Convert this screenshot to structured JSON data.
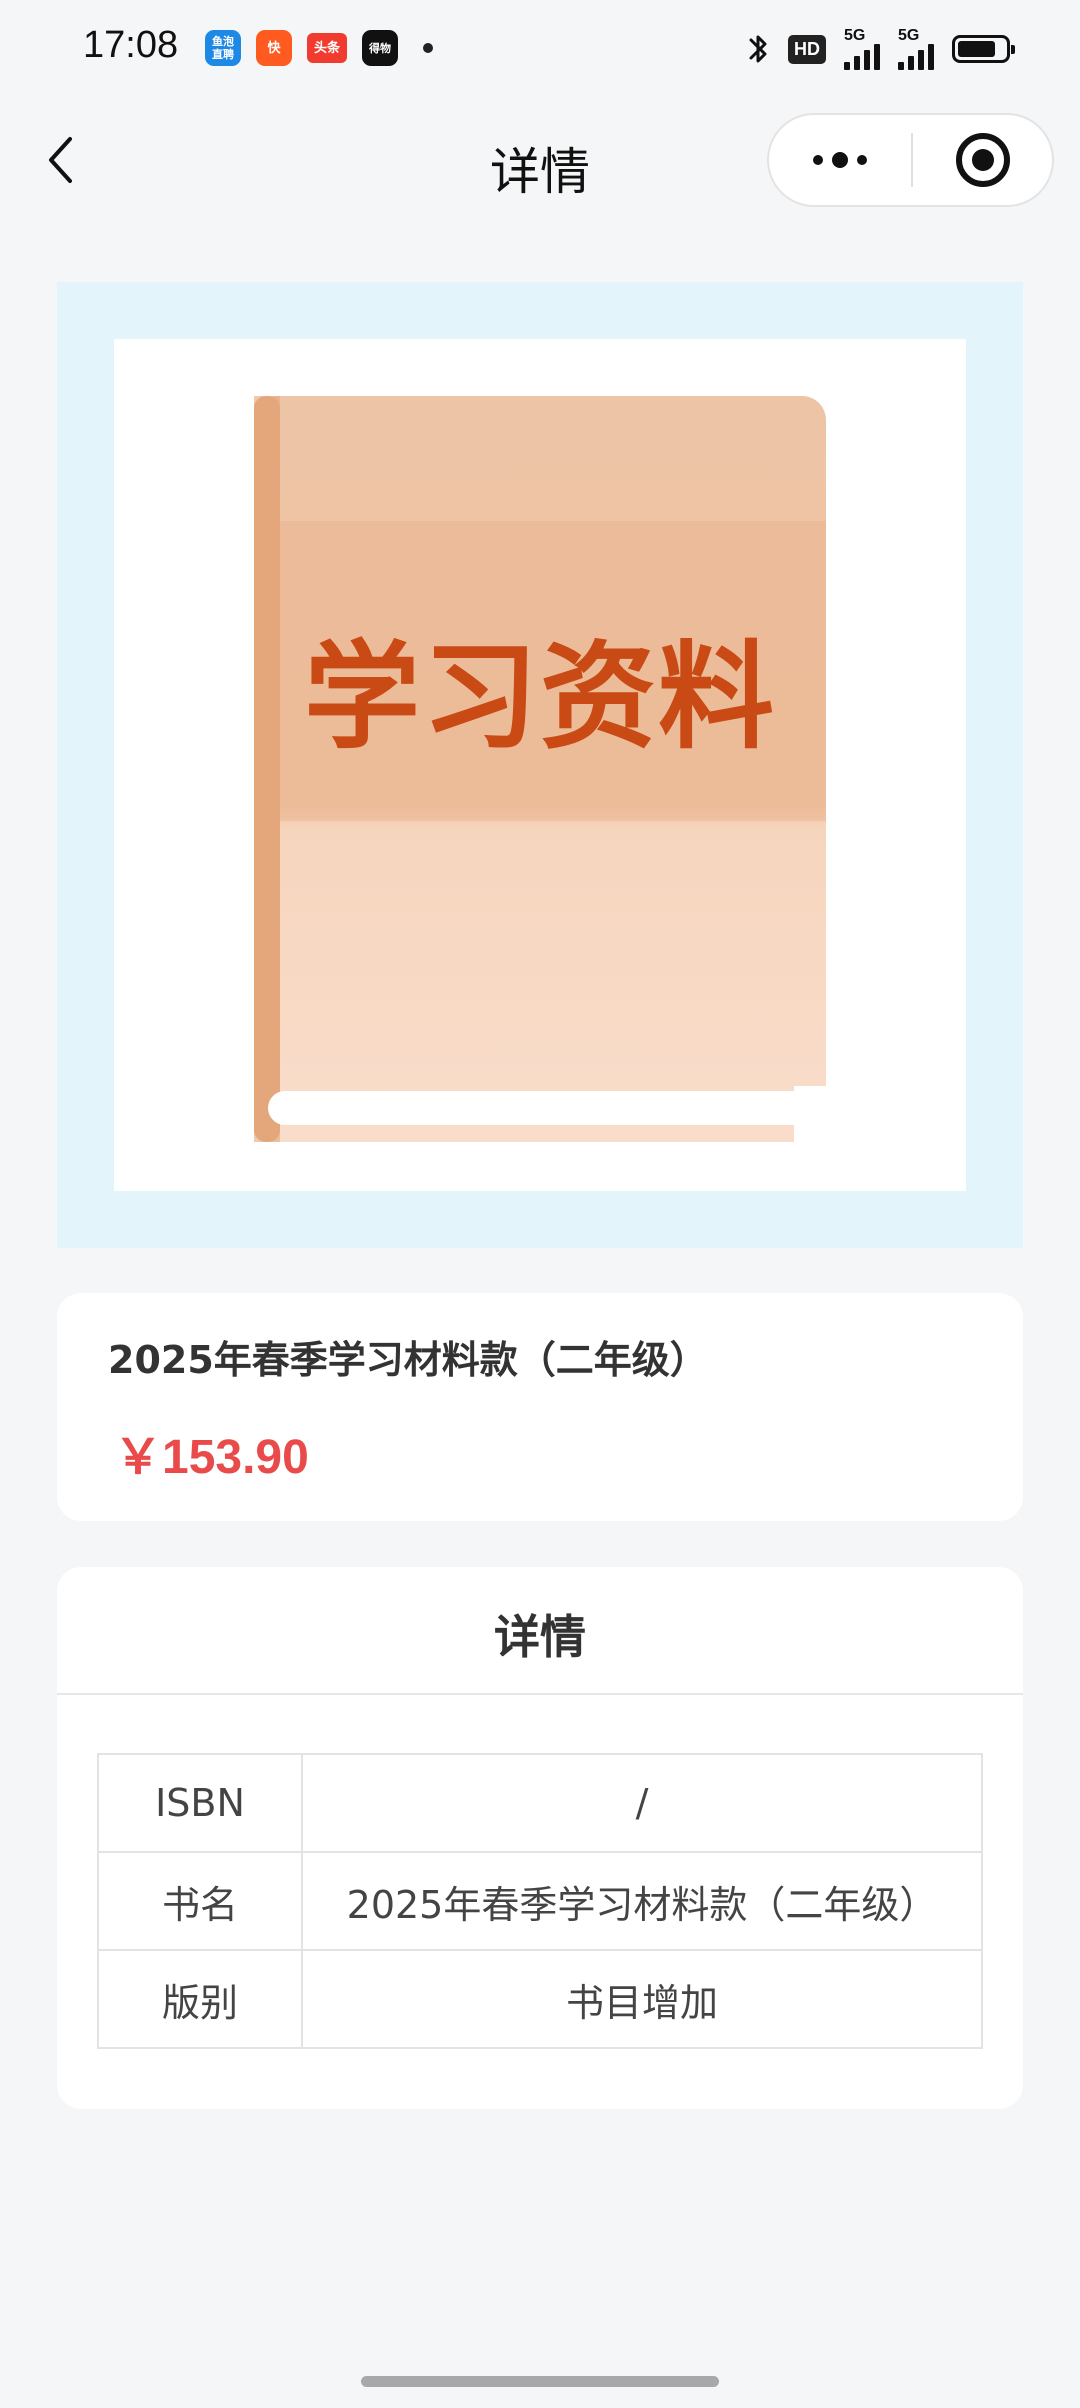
{
  "status_bar": {
    "time": "17:08",
    "apps": [
      {
        "icon": "fish-app-icon",
        "top": "鱼泡",
        "bottom": "直聘"
      },
      {
        "icon": "kuaishou-icon",
        "text": "快"
      },
      {
        "icon": "toutiao-icon",
        "text": "头条"
      },
      {
        "icon": "dewu-icon",
        "text": "得物"
      }
    ],
    "hd_label": "HD",
    "signal_1_label": "5G",
    "signal_2_label": "5G",
    "battery_level": 0.8
  },
  "nav": {
    "title": "详情",
    "back_icon": "chevron-left-icon",
    "more_icon": "more-dots-icon",
    "close_icon": "target-circle-icon"
  },
  "cover": {
    "book_title": "学习资料",
    "colors": {
      "panel_bg": "#e4f4fb",
      "book_top": "#ecc3a3",
      "book_bottom": "#f9ddcb",
      "title": "#c94a14"
    }
  },
  "product": {
    "title": "2025年春季学习材料款（二年级）",
    "price": "￥153.90",
    "price_color": "#e94b4b"
  },
  "details": {
    "heading": "详情",
    "rows": [
      {
        "label": "ISBN",
        "value": "/"
      },
      {
        "label": "书名",
        "value": "2025年春季学习材料款（二年级）"
      },
      {
        "label": "版别",
        "value": "书目增加"
      }
    ]
  }
}
